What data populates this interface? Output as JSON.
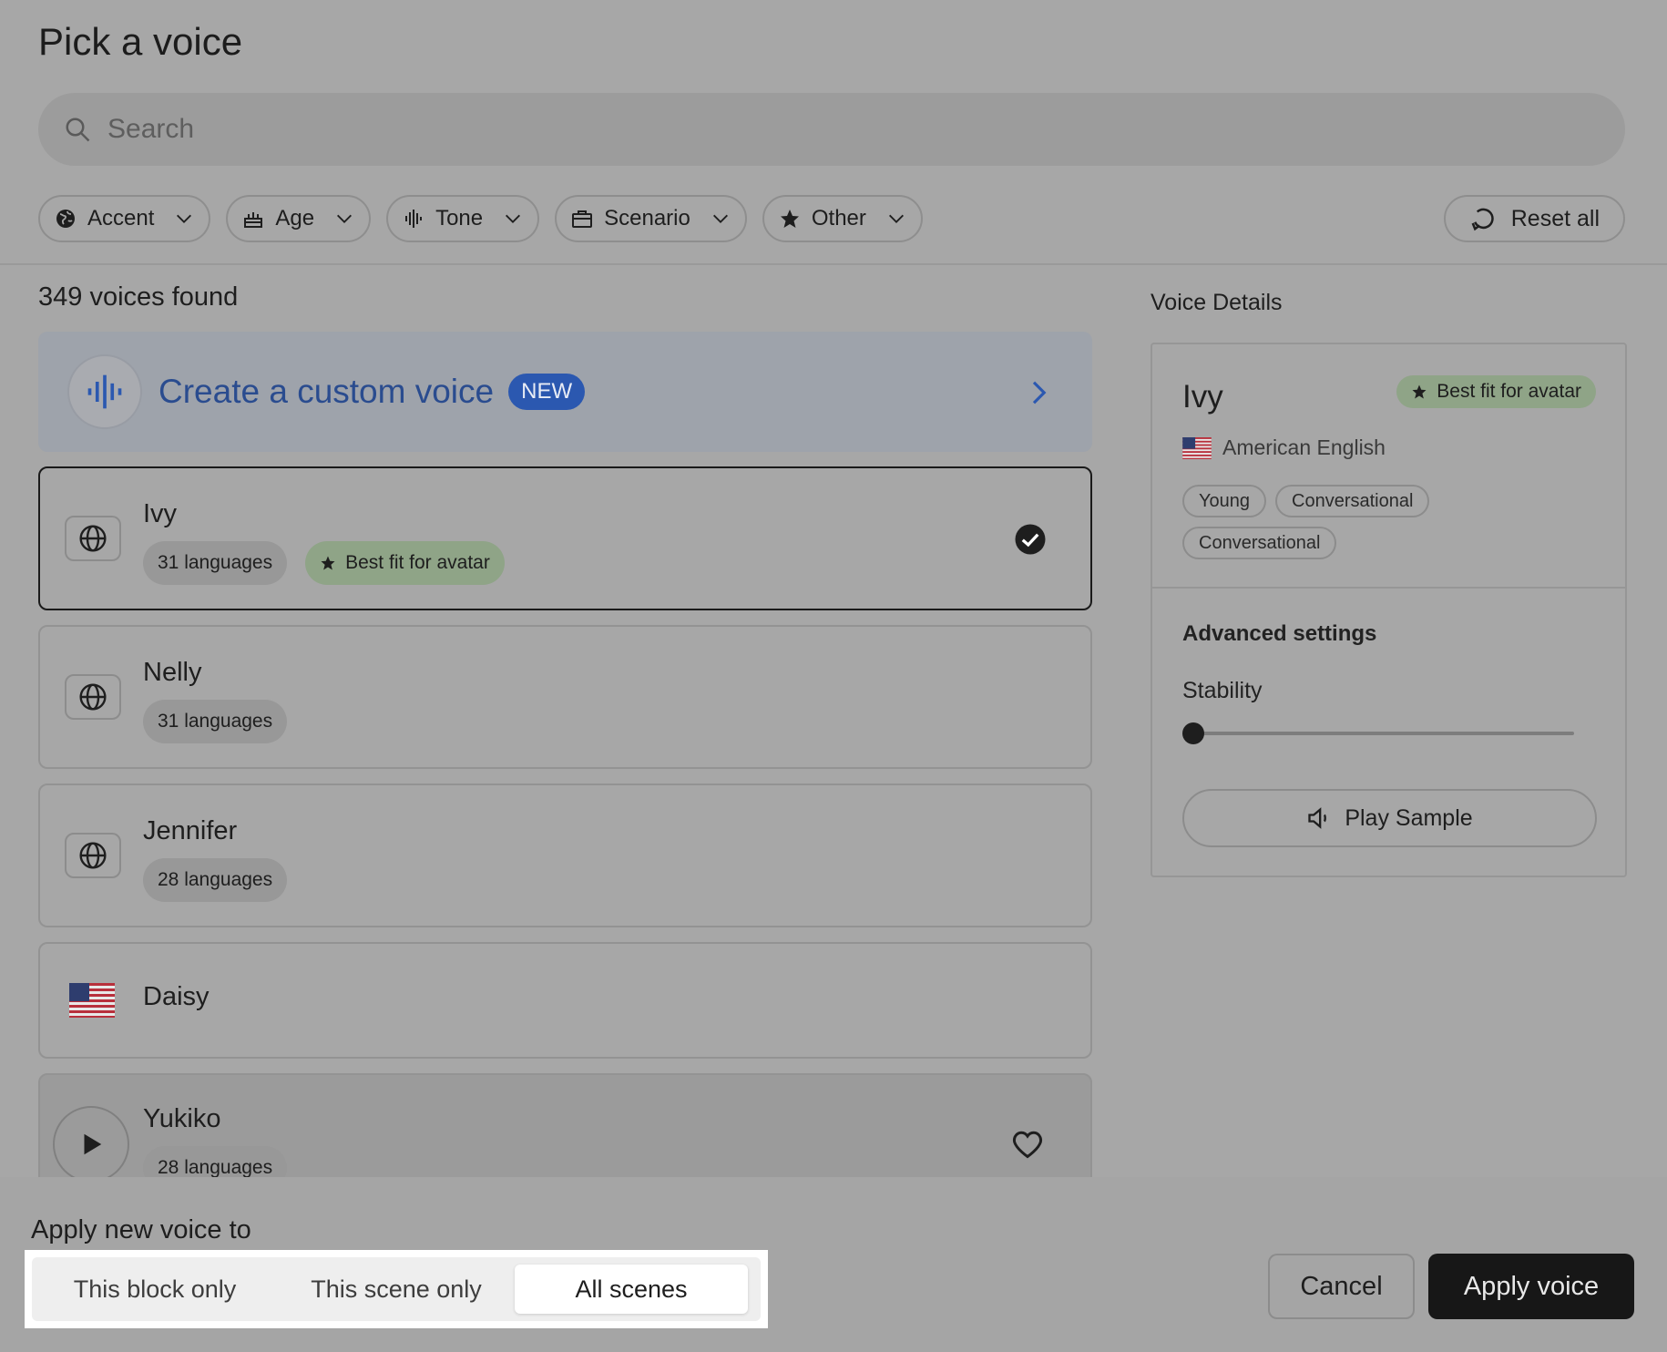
{
  "dialog": {
    "title": "Pick a voice",
    "search_placeholder": "Search"
  },
  "filters": [
    {
      "label": "Accent",
      "icon": "globe-icon"
    },
    {
      "label": "Age",
      "icon": "cake-icon"
    },
    {
      "label": "Tone",
      "icon": "waveform-icon"
    },
    {
      "label": "Scenario",
      "icon": "briefcase-icon"
    },
    {
      "label": "Other",
      "icon": "star-icon"
    }
  ],
  "reset_label": "Reset all",
  "results_count": "349 voices found",
  "custom_voice": {
    "label": "Create a custom voice",
    "badge": "NEW"
  },
  "voices": [
    {
      "name": "Ivy",
      "languages": "31 languages",
      "badge": "Best fit for avatar",
      "selected": true
    },
    {
      "name": "Nelly",
      "languages": "31 languages"
    },
    {
      "name": "Jennifer",
      "languages": "28 languages"
    },
    {
      "name": "Daisy"
    },
    {
      "name": "Yukiko",
      "languages": "28 languages"
    }
  ],
  "details": {
    "section_title": "Voice Details",
    "name": "Ivy",
    "badge": "Best fit for avatar",
    "accent": "American English",
    "tags": [
      "Young",
      "Conversational",
      "Conversational"
    ],
    "advanced_title": "Advanced settings",
    "stability_label": "Stability",
    "stability_value": 0,
    "play_label": "Play Sample"
  },
  "footer": {
    "apply_label": "Apply new voice to",
    "options": [
      "This block only",
      "This scene only",
      "All scenes"
    ],
    "selected_option": "All scenes",
    "cancel_label": "Cancel",
    "apply_button": "Apply voice"
  },
  "colors": {
    "accent_blue": "#2b58b0",
    "best_fit_green": "#8fa487",
    "primary_button": "#171717"
  }
}
